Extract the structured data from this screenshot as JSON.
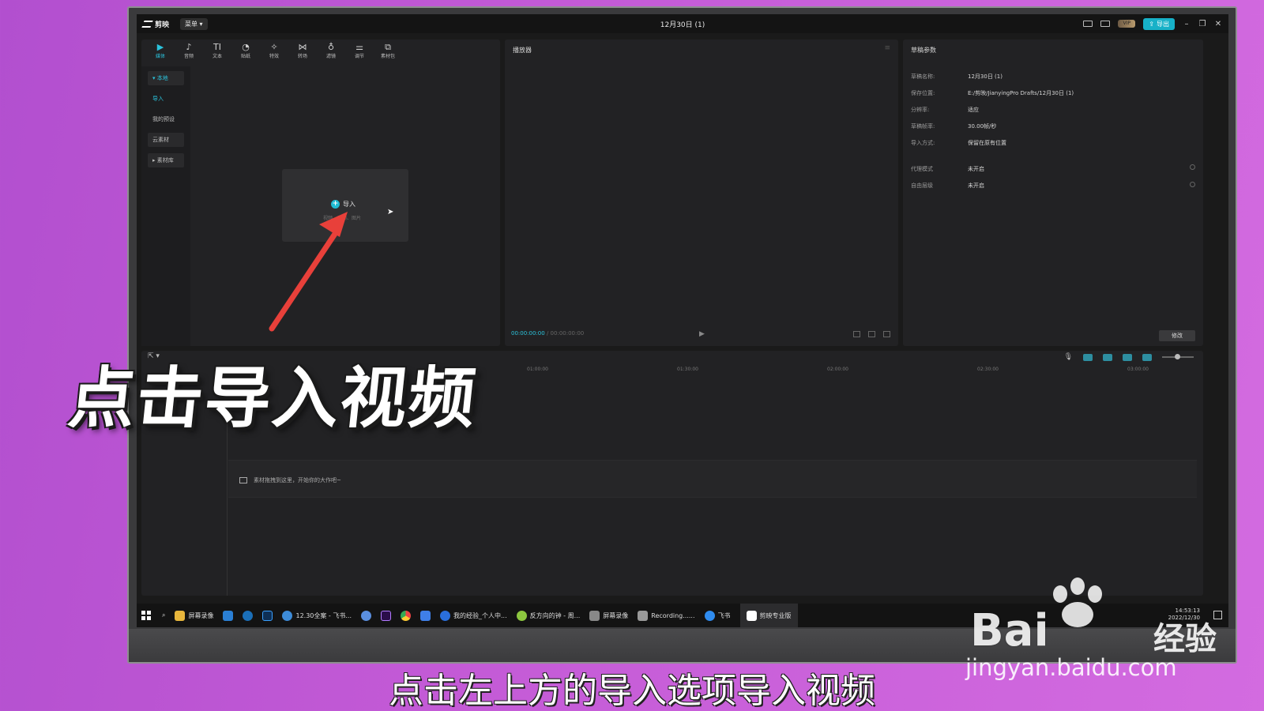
{
  "titlebar": {
    "app_name": "剪映",
    "menu_label": "菜单",
    "project_title": "12月30日 (1)",
    "vip_label": "VIP",
    "export_label": "导出"
  },
  "media_panel": {
    "tools": [
      {
        "label": "媒体",
        "icon": "media-icon",
        "glyph": "▶"
      },
      {
        "label": "音频",
        "icon": "audio-icon",
        "glyph": "♪"
      },
      {
        "label": "文本",
        "icon": "text-icon",
        "glyph": "TI"
      },
      {
        "label": "贴纸",
        "icon": "sticker-icon",
        "glyph": "◔"
      },
      {
        "label": "特效",
        "icon": "effects-icon",
        "glyph": "✧"
      },
      {
        "label": "转场",
        "icon": "transition-icon",
        "glyph": "⋈"
      },
      {
        "label": "滤镜",
        "icon": "filter-icon",
        "glyph": "♁"
      },
      {
        "label": "调节",
        "icon": "adjust-icon",
        "glyph": "⚌"
      },
      {
        "label": "素材包",
        "icon": "package-icon",
        "glyph": "⧉"
      }
    ],
    "sidebar": [
      "本地",
      "导入",
      "我的预设",
      "云素材",
      "素材库"
    ],
    "import_label": "导入",
    "import_hint": "视频、音频、图片"
  },
  "player": {
    "header": "播放器",
    "current_time": "00:00:00:00",
    "total_time": "00:00:00:00"
  },
  "draft": {
    "header": "草稿参数",
    "rows": [
      {
        "key": "草稿名称:",
        "value": "12月30日 (1)"
      },
      {
        "key": "保存位置:",
        "value": "E:/剪映/JianyingPro Drafts/12月30日 (1)"
      },
      {
        "key": "分辨率:",
        "value": "适应"
      },
      {
        "key": "草稿帧率:",
        "value": "30.00帧/秒"
      },
      {
        "key": "导入方式:",
        "value": "保留在原有位置"
      },
      {
        "key": "代理模式",
        "value": "未开启"
      },
      {
        "key": "自由层级",
        "value": "未开启"
      }
    ],
    "modify_label": "修改"
  },
  "timeline": {
    "ruler": [
      "01:00:00",
      "01:30:00",
      "02:00:00",
      "02:30:00",
      "03:00:00"
    ],
    "hint": "素材拖拽到这里，开始你的大作吧~"
  },
  "taskbar": {
    "items": [
      "屏幕录像",
      "12.30全案 - 飞书...",
      "我的经验_个人中...",
      "反方向的钟 - 周...",
      "屏幕录像",
      "Recording......",
      "飞书",
      "剪映专业版"
    ],
    "clock_time": "14:53:13",
    "clock_date": "2022/12/30"
  },
  "overlay": {
    "big_caption": "点击导入视频",
    "subtitle": "点击左上方的导入选项导入视频",
    "arrow_color": "#e8403a"
  },
  "watermark": {
    "brand": "Bai",
    "brand_tail": "经验",
    "url": "jingyan.baidu.com"
  },
  "colors": {
    "accent": "#1fbcd4",
    "background_purple": "#c35ad6"
  }
}
